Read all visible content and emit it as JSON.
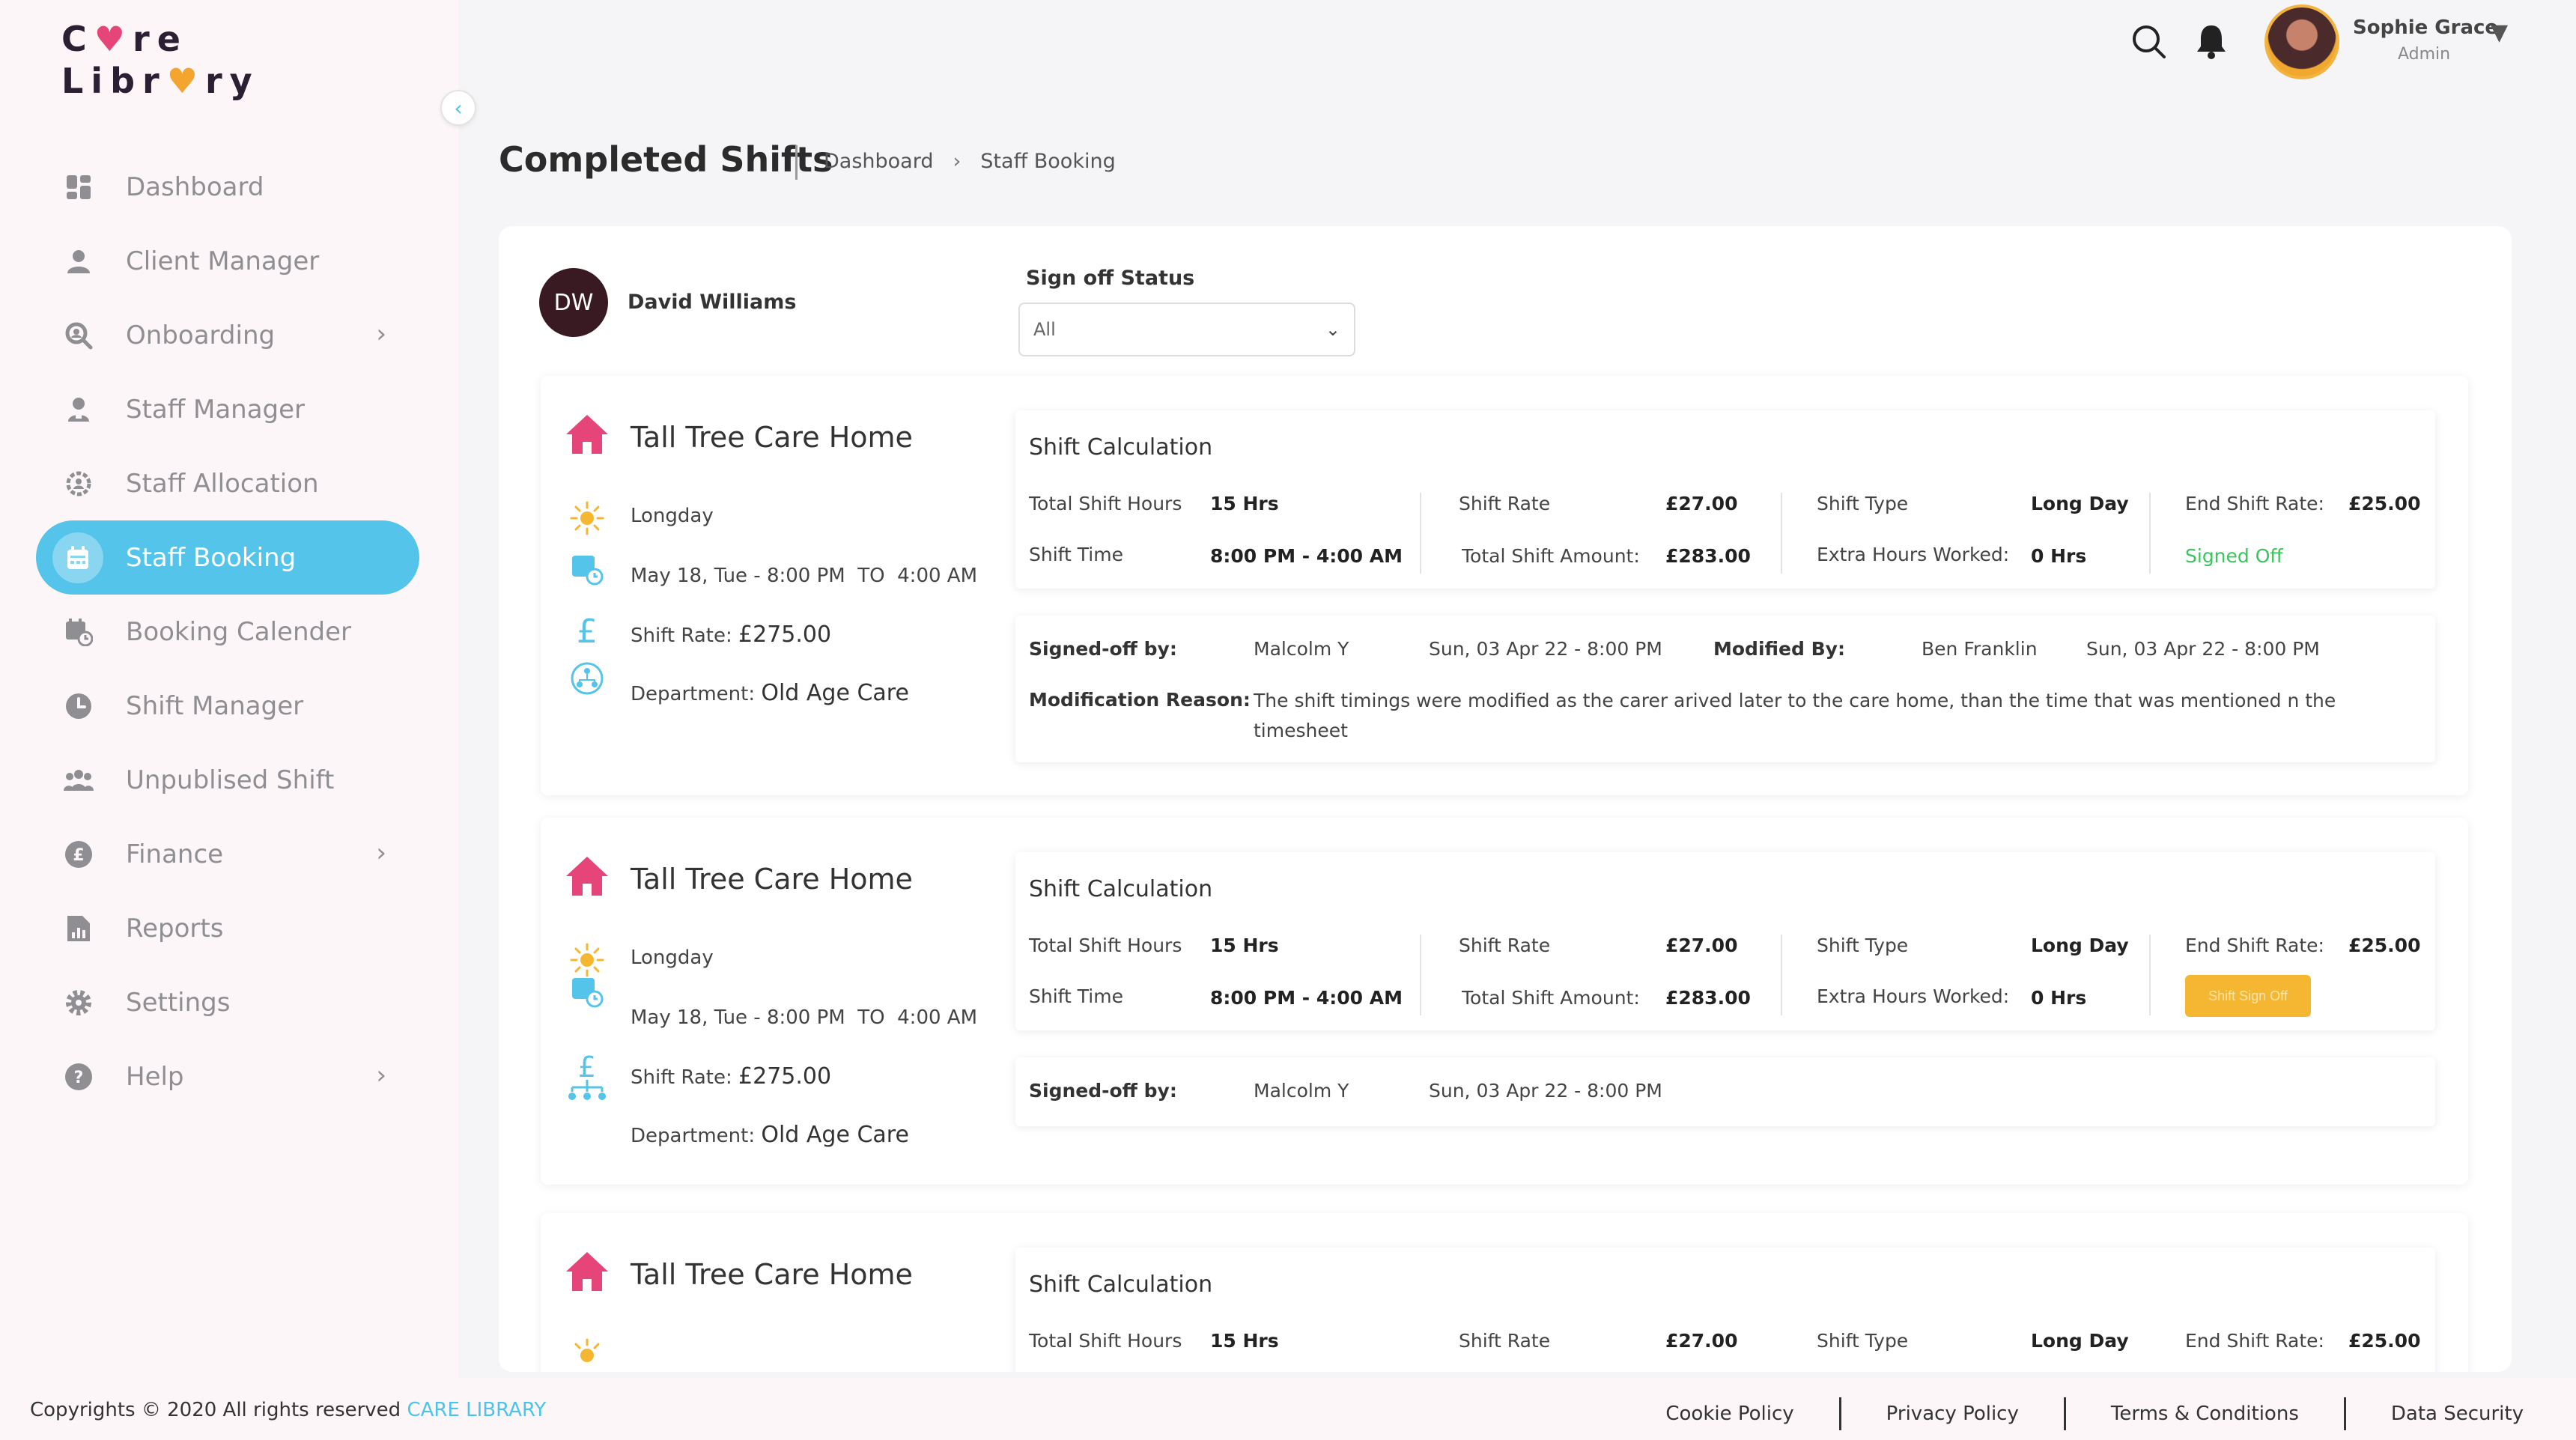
{
  "brand": {
    "logo_line1": "Care",
    "logo_line2": "Library"
  },
  "sidebar": {
    "items": [
      {
        "label": "Dashboard",
        "icon": "dashboard-icon",
        "has_children": false,
        "active": false
      },
      {
        "label": "Client Manager",
        "icon": "user-icon",
        "has_children": false,
        "active": false
      },
      {
        "label": "Onboarding",
        "icon": "onboarding-search-icon",
        "has_children": true,
        "active": false
      },
      {
        "label": "Staff Manager",
        "icon": "staff-user-icon",
        "has_children": false,
        "active": false
      },
      {
        "label": "Staff Allocation",
        "icon": "allocation-gear-icon",
        "has_children": false,
        "active": false
      },
      {
        "label": "Staff Booking",
        "icon": "calendar-icon",
        "has_children": false,
        "active": true
      },
      {
        "label": "Booking Calender",
        "icon": "calendar-clock-icon",
        "has_children": false,
        "active": false
      },
      {
        "label": "Shift Manager",
        "icon": "clock-icon",
        "has_children": false,
        "active": false
      },
      {
        "label": "Unpublised Shift",
        "icon": "group-icon",
        "has_children": false,
        "active": false
      },
      {
        "label": "Finance",
        "icon": "pound-icon",
        "has_children": true,
        "active": false
      },
      {
        "label": "Reports",
        "icon": "report-icon",
        "has_children": false,
        "active": false
      },
      {
        "label": "Settings",
        "icon": "gear-icon",
        "has_children": false,
        "active": false
      },
      {
        "label": "Help",
        "icon": "question-icon",
        "has_children": true,
        "active": false
      }
    ]
  },
  "header": {
    "user_name": "Sophie Grace",
    "user_role": "Admin"
  },
  "page": {
    "title": "Completed Shifts",
    "breadcrumb": [
      "Dashboard",
      "Staff Booking"
    ]
  },
  "staff": {
    "initials": "DW",
    "name": "David Williams"
  },
  "filter": {
    "label": "Sign off Status",
    "value": "All"
  },
  "labels": {
    "shift_calculation": "Shift Calculation",
    "total_shift_hours": "Total Shift Hours",
    "shift_time": "Shift Time",
    "shift_rate": "Shift Rate",
    "total_shift_amount": "Total Shift Amount:",
    "shift_type": "Shift Type",
    "extra_hours": "Extra Hours Worked:",
    "end_shift_rate": "End Shift Rate:",
    "signed_off_by": "Signed-off by:",
    "modified_by": "Modified By:",
    "modification_reason": "Modification Reason:",
    "shift_rate_prefix": "Shift Rate:",
    "department_prefix": "Department:",
    "date_to": "TO"
  },
  "shifts": [
    {
      "venue": "Tall Tree Care Home",
      "shift_kind": "Longday",
      "date": "May 18, Tue - 8:00 PM",
      "end_time": "4:00 AM",
      "rate": "£275.00",
      "department": "Old Age Care",
      "calc": {
        "total_hours": "15 Hrs",
        "time": "8:00 PM - 4:00 AM",
        "rate": "£27.00",
        "amount": "£283.00",
        "type": "Long Day",
        "extra": "0 Hrs",
        "end_rate": "£25.00",
        "status": "Signed Off"
      },
      "signoff": {
        "by": "Malcolm Y",
        "by_date": "Sun, 03 Apr 22 - 8:00 PM",
        "modified_by": "Ben Franklin",
        "modified_date": "Sun, 03 Apr 22 - 8:00 PM",
        "reason": "The shift timings were modified as the carer arived later to the care home, than the time that was mentioned n the timesheet"
      }
    },
    {
      "venue": "Tall Tree Care Home",
      "shift_kind": "Longday",
      "date": "May 18, Tue - 8:00 PM",
      "end_time": "4:00 AM",
      "rate": "£275.00",
      "department": "Old Age Care",
      "calc": {
        "total_hours": "15 Hrs",
        "time": "8:00 PM - 4:00 AM",
        "rate": "£27.00",
        "amount": "£283.00",
        "type": "Long Day",
        "extra": "0 Hrs",
        "end_rate": "£25.00",
        "button": "Shift Sign Off"
      },
      "signoff": {
        "by": "Malcolm Y",
        "by_date": "Sun, 03 Apr 22 - 8:00 PM"
      }
    },
    {
      "venue": "Tall Tree Care Home",
      "calc": {
        "total_hours": "15 Hrs",
        "rate": "£27.00",
        "type": "Long Day",
        "end_rate": "£25.00"
      }
    }
  ],
  "footer": {
    "copyright": "Copyrights © 2020  All rights reserved",
    "brand": "CARE LIBRARY",
    "links": [
      "Cookie Policy",
      "Privacy Policy",
      "Terms & Conditions",
      "Data Security"
    ]
  },
  "colors": {
    "accent": "#55c4eb",
    "brand_pink": "#e6457a",
    "signed_green": "#3cc35b",
    "button_yellow": "#f5b731",
    "avatar_dark": "#3a1a22"
  }
}
